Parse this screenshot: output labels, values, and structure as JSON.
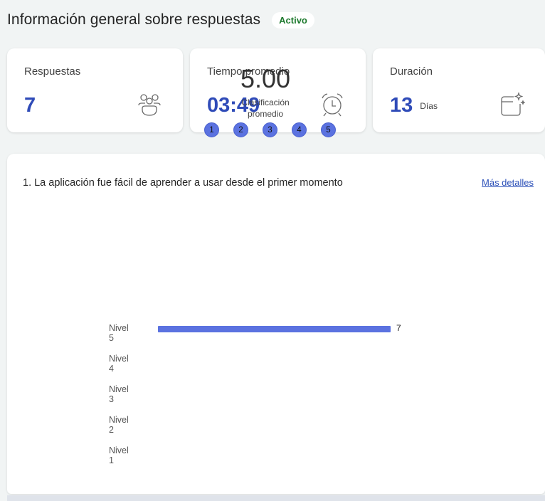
{
  "header": {
    "title": "Información general sobre respuestas",
    "status": "Activo"
  },
  "cards": [
    {
      "label": "Respuestas",
      "value": "7",
      "unit": "",
      "icon": "people-icon"
    },
    {
      "label": "Tiempo promedio",
      "value": "03:49",
      "unit": "",
      "icon": "alarm-clock-icon"
    },
    {
      "label": "Duración",
      "value": "13",
      "unit": "Días",
      "icon": "calendar-sparkle-icon"
    }
  ],
  "question": {
    "text": "1. La aplicación fue fácil de aprender a usar desde el primer momento",
    "details_link": "Más detalles",
    "average_value": "5.00",
    "average_label_line1": "Clasificación",
    "average_label_line2": "promedio",
    "scale": [
      "1",
      "2",
      "3",
      "4",
      "5"
    ]
  },
  "colors": {
    "accent": "#2f4bb8",
    "bar": "#5b72e0",
    "status_green": "#1e7a2e"
  },
  "chart_data": {
    "type": "bar",
    "orientation": "horizontal",
    "categories": [
      "Nivel 5",
      "Nivel 4",
      "Nivel 3",
      "Nivel 2",
      "Nivel 1"
    ],
    "values": [
      7,
      0,
      0,
      0,
      0
    ],
    "data_labels": [
      "7",
      "",
      "",
      "",
      ""
    ],
    "xlim": [
      0,
      7
    ],
    "grid": false
  }
}
